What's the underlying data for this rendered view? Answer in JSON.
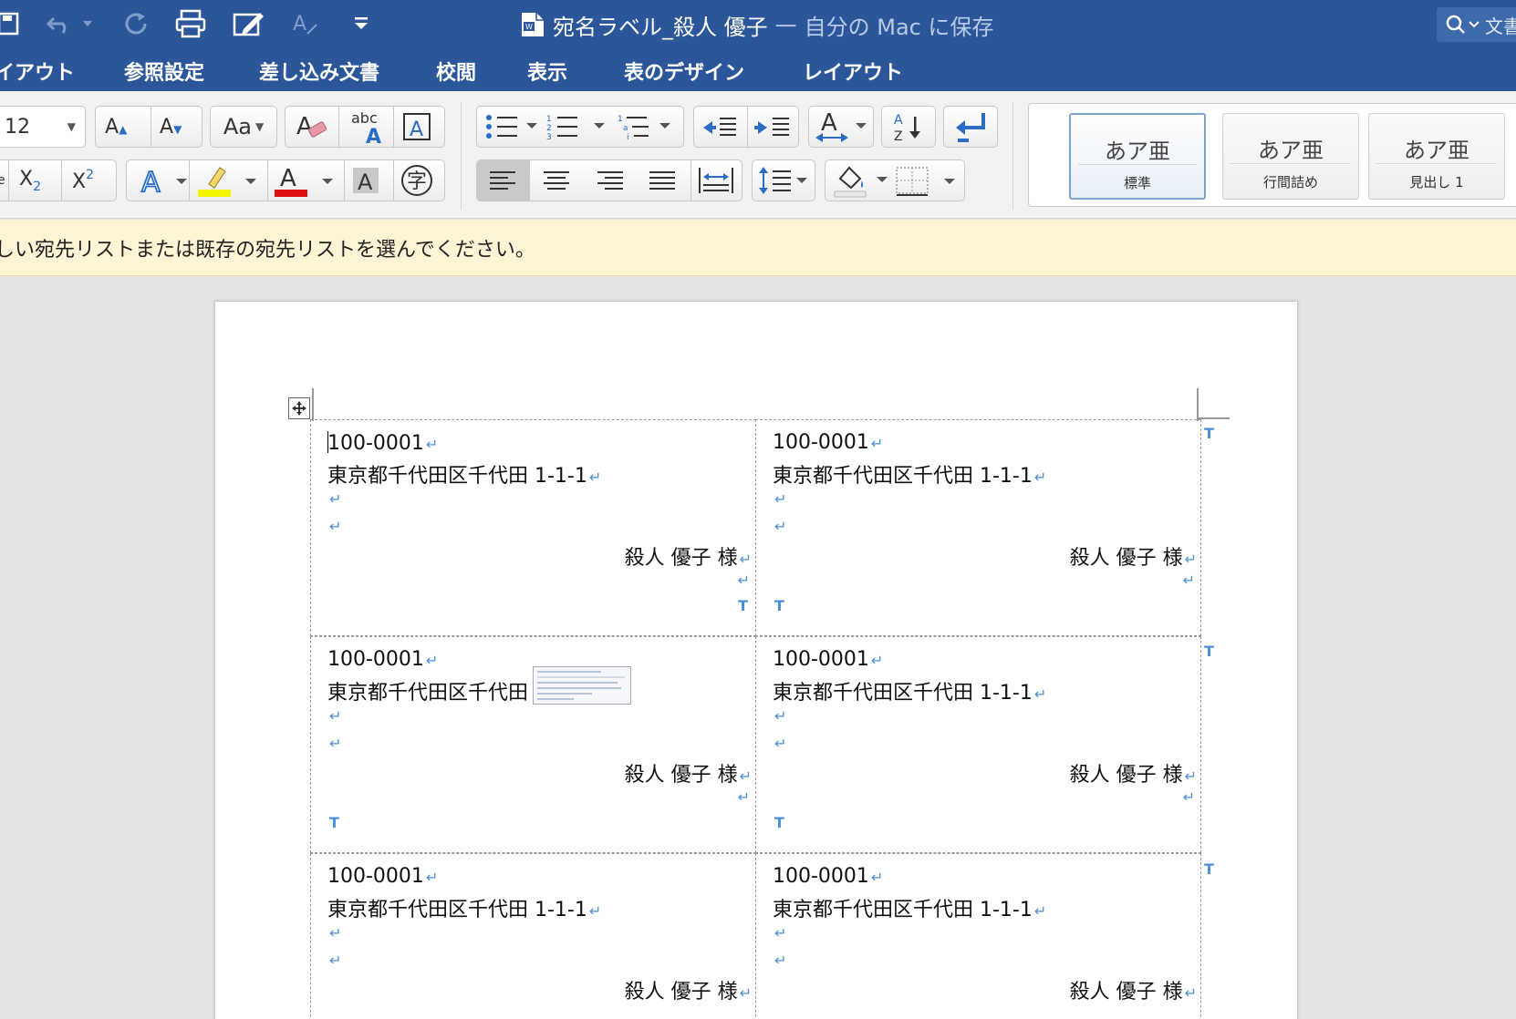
{
  "window": {
    "title": "宛名ラベル_殺人 優子",
    "title_separator": "—",
    "save_location": "自分の Mac に保存",
    "search_hint": "文書"
  },
  "tabs": [
    {
      "label": "イアウト"
    },
    {
      "label": "参照設定"
    },
    {
      "label": "差し込み文書"
    },
    {
      "label": "校閲"
    },
    {
      "label": "表示"
    },
    {
      "label": "表のデザイン",
      "selected": true
    },
    {
      "label": "レイアウト"
    }
  ],
  "ribbon": {
    "font_size": "12",
    "styles": [
      {
        "sample": "あア亜",
        "name": "標準",
        "selected": true
      },
      {
        "sample": "あア亜",
        "name": "行間詰め"
      },
      {
        "sample": "あア亜",
        "name": "見出し 1"
      }
    ]
  },
  "message_bar": {
    "text": "しい宛先リストまたは既存の宛先リストを選んでください。"
  },
  "labels": [
    {
      "postal": "100-0001",
      "address": "東京都千代田区千代田 1-1-1",
      "name": "殺人 優子 様"
    },
    {
      "postal": "100-0001",
      "address": "東京都千代田区千代田 1-1-1",
      "name": "殺人 優子 様"
    },
    {
      "postal": "100-0001",
      "address": "東京都千代田区千代田",
      "name": "殺人 優子 様"
    },
    {
      "postal": "100-0001",
      "address": "東京都千代田区千代田 1-1-1",
      "name": "殺人 優子 様"
    },
    {
      "postal": "100-0001",
      "address": "東京都千代田区千代田 1-1-1",
      "name": "殺人 優子 様"
    },
    {
      "postal": "100-0001",
      "address": "東京都千代田区千代田 1-1-1",
      "name": "殺人 優子 様"
    }
  ],
  "colors": {
    "titlebar": "#2b579a",
    "message_bar": "#fdf4d6",
    "formatting_marks": "#4a90d9"
  }
}
